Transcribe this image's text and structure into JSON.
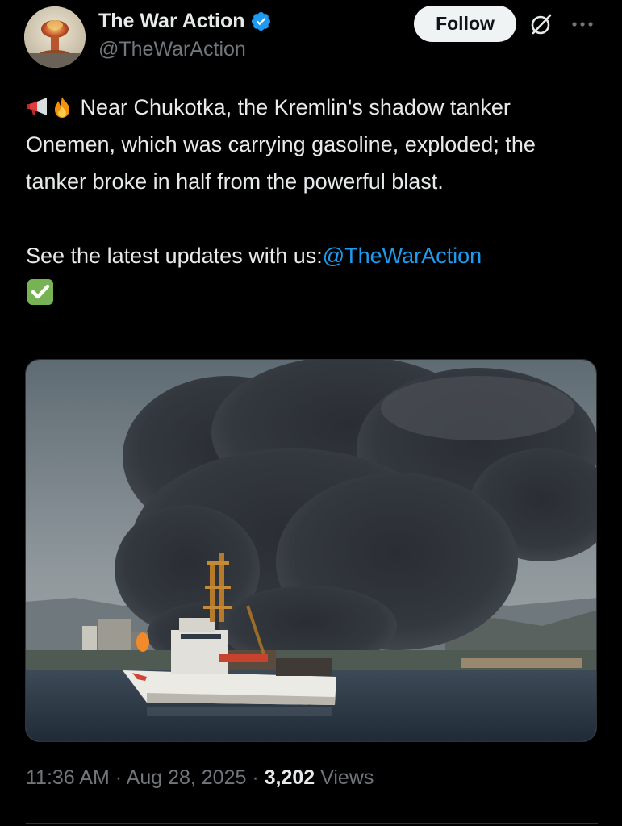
{
  "author": {
    "display_name": "The War Action",
    "handle": "@TheWarAction",
    "verified": true,
    "verified_color": "#1d9bf0"
  },
  "actions": {
    "follow_label": "Follow",
    "grok_icon": "grok-icon",
    "more_icon": "more-icon"
  },
  "post": {
    "line1_emojis": [
      "megaphone-emoji",
      "fire-emoji"
    ],
    "paragraph1": "Near Chukotka, the Kremlin's shadow tanker Onemen, which was carrying gasoline, exploded; the tanker broke in half from the powerful blast.",
    "paragraph2_prefix": "See the latest updates with us:",
    "paragraph2_mention": "@TheWarAction",
    "paragraph2_suffix_emoji": "check-mark-emoji",
    "mention_color": "#1d9bf0"
  },
  "meta": {
    "time": "11:36 AM",
    "separator": "·",
    "date": "Aug 28, 2025",
    "views_count": "3,202",
    "views_label": "Views"
  }
}
